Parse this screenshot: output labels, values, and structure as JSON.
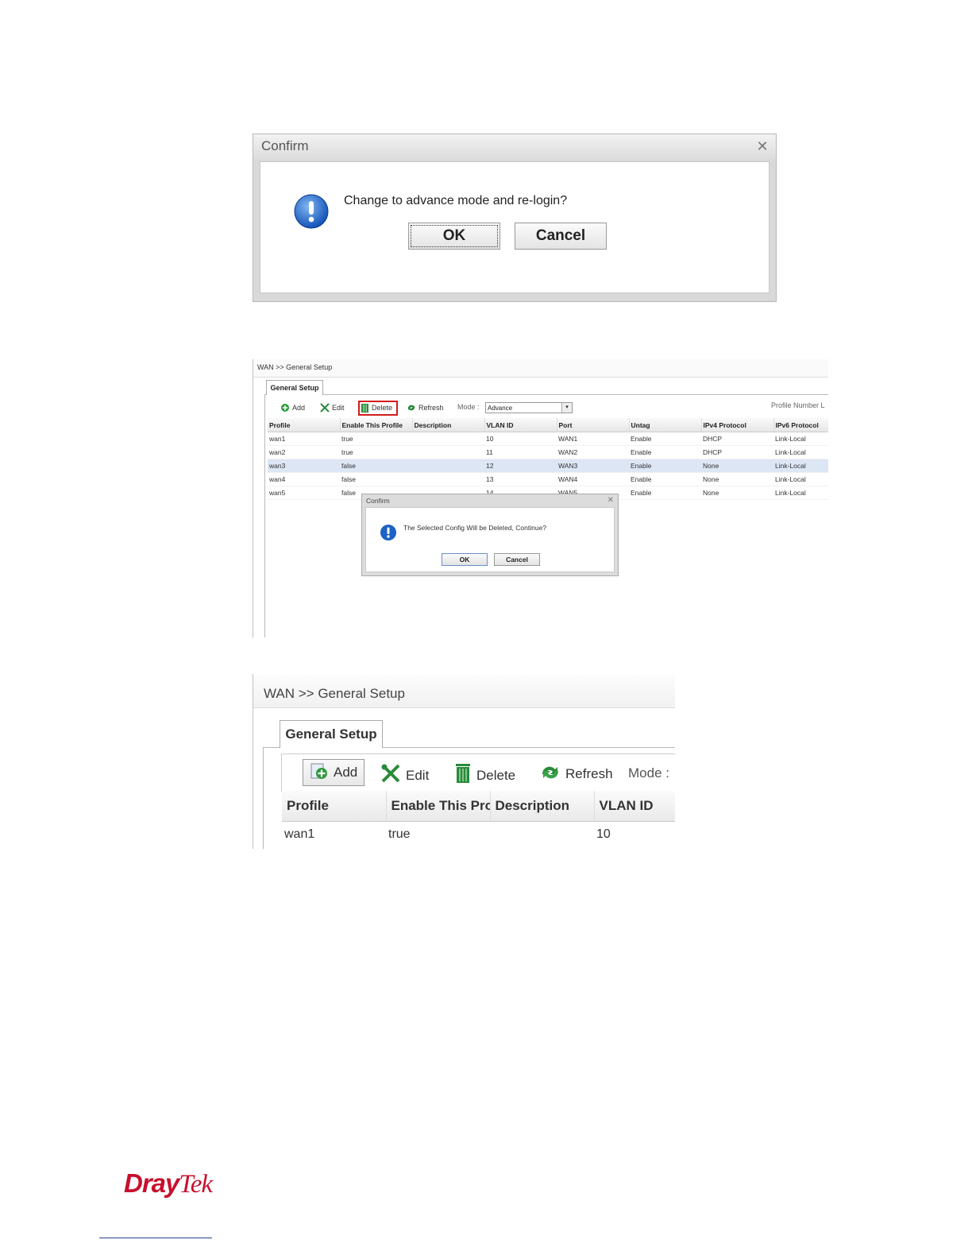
{
  "shot1": {
    "title": "Confirm",
    "message": "Change to advance mode and re-login?",
    "ok_label": "OK",
    "cancel_label": "Cancel"
  },
  "shot2": {
    "breadcrumb": "WAN >> General Setup",
    "tab": "General Setup",
    "toolbar": {
      "add": "Add",
      "edit": "Edit",
      "delete": "Delete",
      "refresh": "Refresh",
      "mode_label": "Mode :",
      "mode_value": "Advance"
    },
    "profile_number_label": "Profile Number L",
    "columns": [
      "Profile",
      "Enable This Profile",
      "Description",
      "VLAN ID",
      "Port",
      "Untag",
      "IPv4 Protocol",
      "IPv6 Protocol"
    ],
    "rows": [
      [
        "wan1",
        "true",
        "",
        "10",
        "WAN1",
        "Enable",
        "DHCP",
        "Link-Local"
      ],
      [
        "wan2",
        "true",
        "",
        "11",
        "WAN2",
        "Enable",
        "DHCP",
        "Link-Local"
      ],
      [
        "wan3",
        "false",
        "",
        "12",
        "WAN3",
        "Enable",
        "None",
        "Link-Local"
      ],
      [
        "wan4",
        "false",
        "",
        "13",
        "WAN4",
        "Enable",
        "None",
        "Link-Local"
      ],
      [
        "wan5",
        "false",
        "",
        "14",
        "WAN5",
        "Enable",
        "None",
        "Link-Local"
      ]
    ],
    "selected_row": 2,
    "confirm": {
      "title": "Confirm",
      "message": "The Selected Config Will be Deleted, Continue?",
      "ok_label": "OK",
      "cancel_label": "Cancel"
    }
  },
  "shot3": {
    "breadcrumb": "WAN >> General Setup",
    "tab": "General Setup",
    "toolbar": {
      "add": "Add",
      "edit": "Edit",
      "delete": "Delete",
      "refresh": "Refresh",
      "mode": "Mode :"
    },
    "columns": [
      "Profile",
      "Enable This Pro",
      "Description",
      "VLAN ID"
    ],
    "row": [
      "wan1",
      "true",
      "",
      "10"
    ]
  },
  "footer": {
    "logo_dray": "Dray",
    "logo_tek": "Tek"
  },
  "colors": {
    "highlight": "#d01c1c",
    "selected_row": "#dde6f5",
    "brand": "#c8102e"
  }
}
